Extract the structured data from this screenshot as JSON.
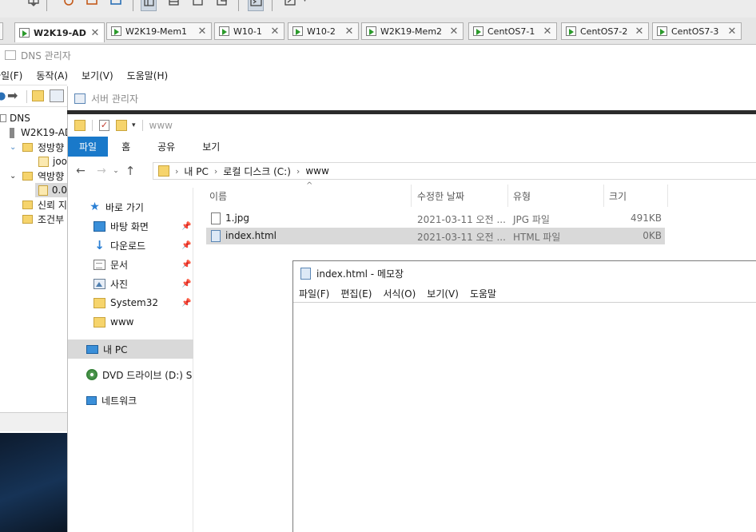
{
  "vm_tabs": [
    {
      "label": "W2K19-AD",
      "active": true
    },
    {
      "label": "W2K19-Mem1",
      "active": false
    },
    {
      "label": "W10-1",
      "active": false
    },
    {
      "label": "W10-2",
      "active": false
    },
    {
      "label": "W2K19-Mem2",
      "active": false
    },
    {
      "label": "CentOS7-1",
      "active": false
    },
    {
      "label": "CentOS7-2",
      "active": false
    },
    {
      "label": "CentOS7-3",
      "active": false
    }
  ],
  "dns": {
    "title": "DNS 관리자",
    "menu": [
      "파일(F)",
      "동작(A)",
      "보기(V)",
      "도움말(H)"
    ],
    "tree": [
      "DNS",
      "W2K19-AD",
      "정방향",
      "joo",
      "역방향",
      "0.0",
      "신뢰 지",
      "조건부"
    ]
  },
  "server_manager": {
    "title": "서버 관리자"
  },
  "explorer": {
    "qat_title": "www",
    "ribbon_tabs": [
      "파일",
      "홈",
      "공유",
      "보기"
    ],
    "breadcrumb": [
      "내 PC",
      "로컬 디스크 (C:)",
      "www"
    ],
    "nav": {
      "quick_access": "바로 가기",
      "items": [
        {
          "label": "바탕 화면",
          "icon": "desktop-icon",
          "pinned": true
        },
        {
          "label": "다운로드",
          "icon": "download-icon",
          "pinned": true
        },
        {
          "label": "문서",
          "icon": "documents-icon",
          "pinned": true
        },
        {
          "label": "사진",
          "icon": "pictures-icon",
          "pinned": true
        },
        {
          "label": "System32",
          "icon": "folder-icon",
          "pinned": true
        },
        {
          "label": "www",
          "icon": "folder-icon",
          "pinned": false
        }
      ],
      "this_pc": "내 PC",
      "dvd": "DVD 드라이브 (D:) S",
      "network": "네트워크"
    },
    "columns": {
      "name": "이름",
      "modified": "수정한 날짜",
      "type": "유형",
      "size": "크기"
    },
    "files": [
      {
        "name": "1.jpg",
        "modified": "2021-03-11 오전 ...",
        "type": "JPG 파일",
        "size": "491KB"
      },
      {
        "name": "index.html",
        "modified": "2021-03-11 오전 ...",
        "type": "HTML 파일",
        "size": "0KB"
      }
    ]
  },
  "notepad": {
    "title": "index.html - 메모장",
    "menu": [
      "파일(F)",
      "편집(E)",
      "서식(O)",
      "보기(V)",
      "도움말"
    ],
    "content": ""
  }
}
